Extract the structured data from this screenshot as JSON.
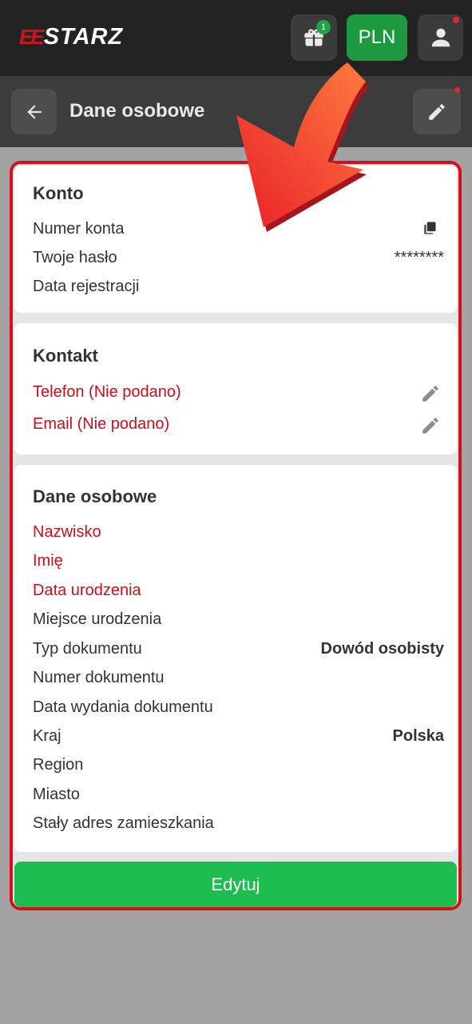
{
  "header": {
    "logo_mark": "EE",
    "logo_text": "STARZ",
    "gift_badge": "1",
    "currency_label": "PLN"
  },
  "subheader": {
    "title": "Dane osobowe"
  },
  "account": {
    "heading": "Konto",
    "rows": [
      {
        "label": "Numer konta",
        "value": ""
      },
      {
        "label": "Twoje hasło",
        "value": "********"
      },
      {
        "label": "Data rejestracji",
        "value": ""
      }
    ]
  },
  "contact": {
    "heading": "Kontakt",
    "phone_label": "Telefon (Nie podano)",
    "email_label": "Email (Nie podano)"
  },
  "personal": {
    "heading": "Dane osobowe",
    "rows": [
      {
        "label": "Nazwisko",
        "value": "",
        "required": true
      },
      {
        "label": "Imię",
        "value": "",
        "required": true
      },
      {
        "label": "Data urodzenia",
        "value": "",
        "required": true
      },
      {
        "label": "Miejsce urodzenia",
        "value": ""
      },
      {
        "label": "Typ dokumentu",
        "value": "Dowód osobisty"
      },
      {
        "label": "Numer dokumentu",
        "value": ""
      },
      {
        "label": "Data wydania dokumentu",
        "value": ""
      },
      {
        "label": "Kraj",
        "value": "Polska"
      },
      {
        "label": "Region",
        "value": ""
      },
      {
        "label": "Miasto",
        "value": ""
      },
      {
        "label": "Stały adres zamieszkania",
        "value": ""
      }
    ]
  },
  "footer": {
    "edit_label": "Edytuj"
  },
  "icons": {
    "gift": "gift-icon",
    "user": "user-icon",
    "back": "arrow-left-icon",
    "edit": "pencil-icon",
    "copy": "copy-icon"
  },
  "colors": {
    "brand_red": "#d6101a",
    "required_red": "#c8101c",
    "accent_green": "#1ebd4f",
    "currency_green": "#1d9a3f",
    "topbar": "#232323",
    "subbar": "#3c3c3c"
  }
}
